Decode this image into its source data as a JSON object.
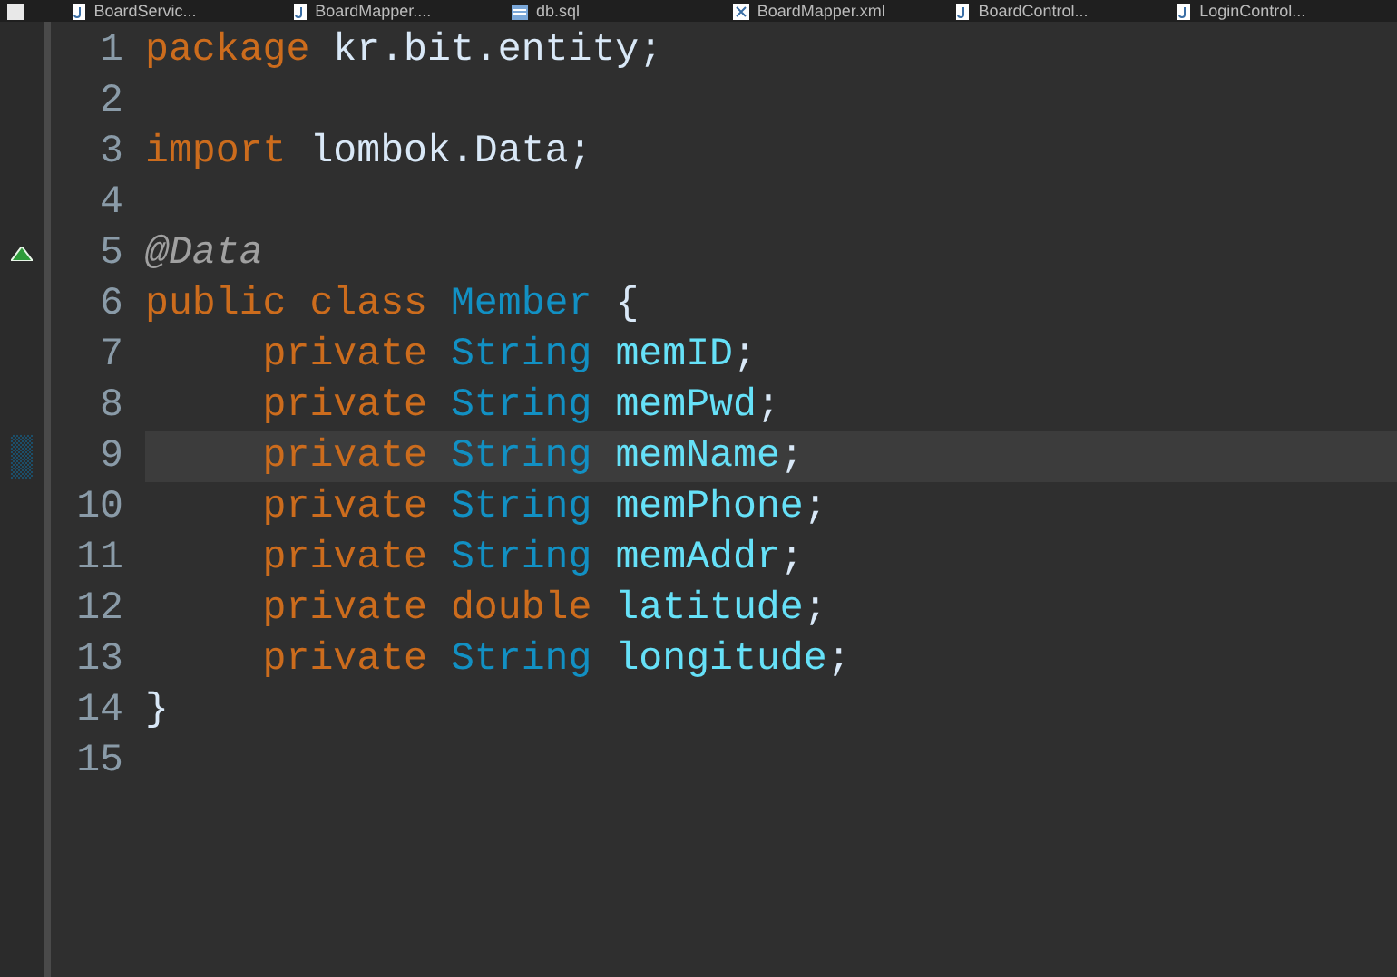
{
  "tabs": [
    {
      "label": "BoardServic...",
      "kind": "java",
      "selected": false
    },
    {
      "label": "BoardMapper....",
      "kind": "java",
      "selected": false
    },
    {
      "label": "db.sql",
      "kind": "sql",
      "selected": false
    },
    {
      "label": "BoardMapper.xml",
      "kind": "xml",
      "selected": false
    },
    {
      "label": "BoardControl...",
      "kind": "java",
      "selected": false
    },
    {
      "label": "LoginControl...",
      "kind": "java",
      "selected": false
    }
  ],
  "editor": {
    "lines": [
      {
        "number": "1",
        "kind": "plain",
        "current": false,
        "tokens": [
          {
            "kind": "keyword",
            "text": "package"
          },
          {
            "kind": "plain",
            "text": " kr.bit.entity;"
          }
        ]
      },
      {
        "number": "2",
        "kind": "plain",
        "current": false
      },
      {
        "number": "3",
        "kind": "plain",
        "current": false,
        "tokens": [
          {
            "kind": "keyword",
            "text": "import"
          },
          {
            "kind": "plain",
            "text": " lombok.Data;"
          }
        ]
      },
      {
        "number": "4",
        "kind": "plain",
        "current": false
      },
      {
        "number": "5",
        "kind": "annotation-marker",
        "current": false,
        "tokens": [
          {
            "kind": "annotation",
            "text": "@Data"
          }
        ]
      },
      {
        "number": "6",
        "kind": "plain",
        "current": false,
        "tokens": [
          {
            "kind": "keyword",
            "text": "public class"
          },
          {
            "kind": "type",
            "text": " Member"
          },
          {
            "kind": "plain",
            "text": " {"
          }
        ]
      },
      {
        "number": "7",
        "kind": "plain",
        "current": false,
        "tokens": [
          {
            "kind": "keyword",
            "text": "     private"
          },
          {
            "kind": "type",
            "text": " String"
          },
          {
            "kind": "field",
            "text": " memID"
          },
          {
            "kind": "plain",
            "text": ";"
          }
        ]
      },
      {
        "number": "8",
        "kind": "plain",
        "current": false,
        "tokens": [
          {
            "kind": "keyword",
            "text": "     private"
          },
          {
            "kind": "type",
            "text": " String"
          },
          {
            "kind": "field",
            "text": " memPwd"
          },
          {
            "kind": "plain",
            "text": ";"
          }
        ]
      },
      {
        "number": "9",
        "kind": "change-marker",
        "current": true,
        "tokens": [
          {
            "kind": "keyword",
            "text": "     private"
          },
          {
            "kind": "type",
            "text": " String"
          },
          {
            "kind": "field",
            "text": " memName"
          },
          {
            "kind": "plain",
            "text": ";"
          }
        ]
      },
      {
        "number": "10",
        "kind": "plain",
        "current": false,
        "tokens": [
          {
            "kind": "keyword",
            "text": "     private"
          },
          {
            "kind": "type",
            "text": " String"
          },
          {
            "kind": "field",
            "text": " memPhone"
          },
          {
            "kind": "plain",
            "text": ";"
          }
        ]
      },
      {
        "number": "11",
        "kind": "plain",
        "current": false,
        "tokens": [
          {
            "kind": "keyword",
            "text": "     private"
          },
          {
            "kind": "type",
            "text": " String"
          },
          {
            "kind": "field",
            "text": " memAddr"
          },
          {
            "kind": "plain",
            "text": ";"
          }
        ]
      },
      {
        "number": "12",
        "kind": "plain",
        "current": false,
        "tokens": [
          {
            "kind": "keyword",
            "text": "     private double"
          },
          {
            "kind": "field",
            "text": " latitude"
          },
          {
            "kind": "plain",
            "text": ";"
          }
        ]
      },
      {
        "number": "13",
        "kind": "plain",
        "current": false,
        "tokens": [
          {
            "kind": "keyword",
            "text": "     private"
          },
          {
            "kind": "type",
            "text": " String"
          },
          {
            "kind": "field",
            "text": " longitude"
          },
          {
            "kind": "plain",
            "text": ";"
          }
        ]
      },
      {
        "number": "14",
        "kind": "plain",
        "current": false,
        "tokens": [
          {
            "kind": "plain",
            "text": "}"
          }
        ]
      },
      {
        "number": "15",
        "kind": "plain",
        "current": false
      }
    ]
  }
}
